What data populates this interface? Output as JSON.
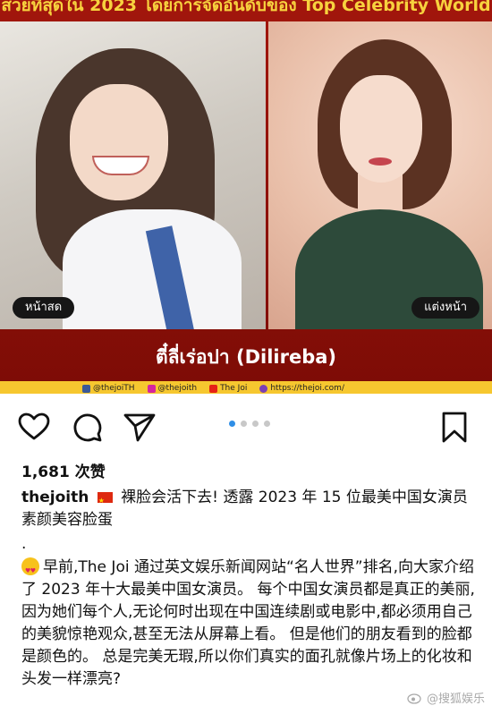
{
  "post_image": {
    "headline": "สวยที่สุดใน 2023 โดยการจัดอันดับของ Top Celebrity World",
    "left_tag": "หน้าสด",
    "right_tag": "แต่งหน้า",
    "name_caption": "ตี๋ลี่เร่อปา (Dilireba)",
    "footer": {
      "facebook": "@thejoiTH",
      "instagram": "@thejoith",
      "youtube": "The Joi",
      "website": "https://thejoi.com/"
    },
    "colors": {
      "background": "#8f1208",
      "headline": "#f7d23e",
      "footer_band": "#f6c72f"
    }
  },
  "actions": {
    "like_icon": "heart-icon",
    "comment_icon": "comment-icon",
    "share_icon": "send-icon",
    "save_icon": "bookmark-icon"
  },
  "carousel": {
    "total": 4,
    "active": 1,
    "active_color": "#2f8ee6"
  },
  "likes_text": "1,681 次赞",
  "caption": {
    "username": "thejoith",
    "text_after_flag": "裸脸会活下去! 透露 2023 年 15 位最美中国女演员素颜美容脸蛋"
  },
  "separator": ".",
  "body": "早前,The Joi 通过英文娱乐新闻网站“名人世界”排名,向大家介绍了 2023 年十大最美中国女演员。 每个中国女演员都是真正的美丽,因为她们每个人,无论何时出现在中国连续剧或电影中,都必须用自己的美貌惊艳观众,甚至无法从屏幕上看。 但是他们的朋友看到的脸都是颜色的。 总是完美无瑕,所以你们真实的面孔就像片场上的化妆和头发一样漂亮?",
  "watermark": "@搜狐娱乐"
}
